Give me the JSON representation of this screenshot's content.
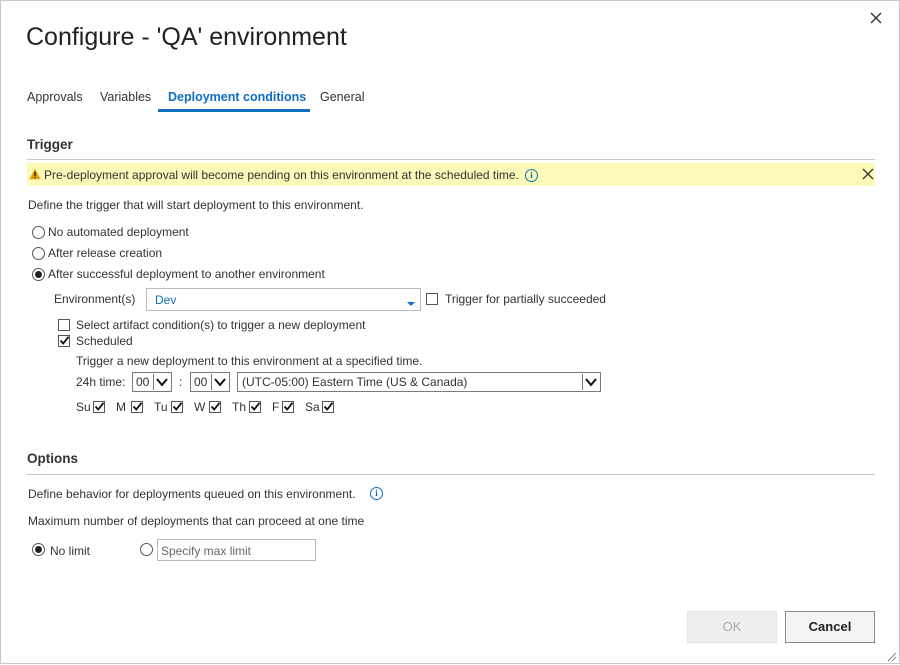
{
  "dialog": {
    "title": "Configure - 'QA' environment"
  },
  "tabs": [
    {
      "label": "Approvals"
    },
    {
      "label": "Variables"
    },
    {
      "label": "Deployment conditions"
    },
    {
      "label": "General"
    }
  ],
  "trigger": {
    "heading": "Trigger",
    "banner_text": "Pre-deployment approval will become pending on this environment at the scheduled time.",
    "description": "Define the trigger that will start deployment to this environment.",
    "options": [
      {
        "label": "No automated deployment",
        "selected": false
      },
      {
        "label": "After release creation",
        "selected": false
      },
      {
        "label": "After successful deployment to another environment",
        "selected": true
      }
    ],
    "environments_label": "Environment(s)",
    "environments_value": "Dev",
    "partial_label": "Trigger for partially succeeded",
    "artifact_label": "Select artifact condition(s) to trigger a new deployment",
    "scheduled_label": "Scheduled",
    "schedule_hint": "Trigger a new deployment to this environment at a specified time.",
    "time_label": "24h time:",
    "hour": "00",
    "time_sep": ":",
    "minute": "00",
    "timezone": "(UTC-05:00) Eastern Time (US & Canada)",
    "days": [
      {
        "label": "Su",
        "checked": true
      },
      {
        "label": "M",
        "checked": true
      },
      {
        "label": "Tu",
        "checked": true
      },
      {
        "label": "W",
        "checked": true
      },
      {
        "label": "Th",
        "checked": true
      },
      {
        "label": "F",
        "checked": true
      },
      {
        "label": "Sa",
        "checked": true
      }
    ]
  },
  "options_section": {
    "heading": "Options",
    "description": "Define behavior for deployments queued on this environment.",
    "max_label": "Maximum number of deployments that can proceed at one time",
    "no_limit_label": "No limit",
    "max_placeholder": "Specify max limit"
  },
  "buttons": {
    "ok": "OK",
    "cancel": "Cancel"
  },
  "colors": {
    "accent": "#106ebe",
    "banner_bg": "#fbf9b8",
    "warning": "#e8a200"
  }
}
